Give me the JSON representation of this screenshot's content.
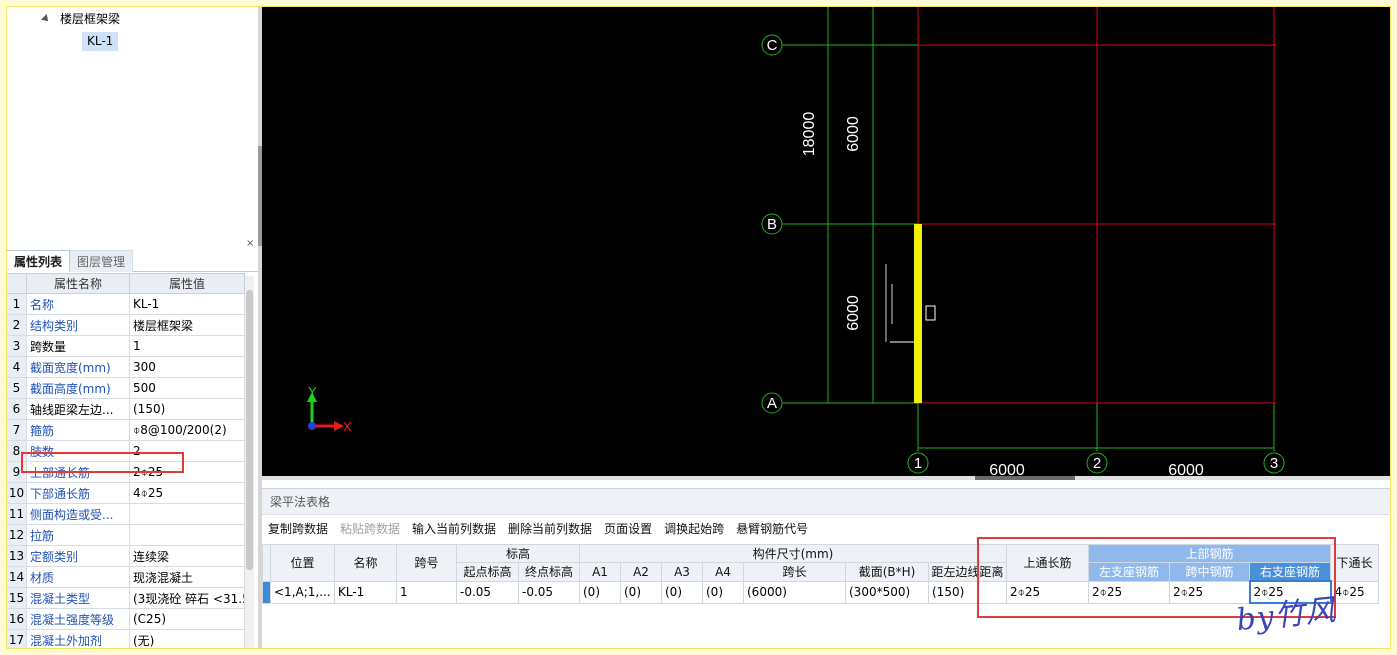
{
  "tree": {
    "node_label": "楼层框架梁",
    "leaf_label": "KL-1"
  },
  "props_panel": {
    "close_glyph": "×",
    "tab_active": "属性列表",
    "tab_inactive": "图层管理",
    "col_name": "属性名称",
    "col_value": "属性值",
    "rows": [
      {
        "num": "1",
        "name": "名称",
        "value": "KL-1",
        "blue": true
      },
      {
        "num": "2",
        "name": "结构类别",
        "value": "楼层框架梁",
        "blue": true
      },
      {
        "num": "3",
        "name": "跨数量",
        "value": "1",
        "blue": false
      },
      {
        "num": "4",
        "name": "截面宽度(mm)",
        "value": "300",
        "blue": true
      },
      {
        "num": "5",
        "name": "截面高度(mm)",
        "value": "500",
        "blue": true
      },
      {
        "num": "6",
        "name": "轴线距梁左边...",
        "value": "(150)",
        "blue": false
      },
      {
        "num": "7",
        "name": "箍筋",
        "value": "⌽8@100/200(2)",
        "blue": true
      },
      {
        "num": "8",
        "name": "肢数",
        "value": "2",
        "blue": true
      },
      {
        "num": "9",
        "name": "上部通长筋",
        "value": "2⌽25",
        "blue": true
      },
      {
        "num": "10",
        "name": "下部通长筋",
        "value": "4⌽25",
        "blue": true
      },
      {
        "num": "11",
        "name": "侧面构造或受...",
        "value": "",
        "blue": true
      },
      {
        "num": "12",
        "name": "拉筋",
        "value": "",
        "blue": true
      },
      {
        "num": "13",
        "name": "定额类别",
        "value": "连续梁",
        "blue": true
      },
      {
        "num": "14",
        "name": "材质",
        "value": "现浇混凝土",
        "blue": true
      },
      {
        "num": "15",
        "name": "混凝土类型",
        "value": "(3现浇砼 碎石 <31.5",
        "blue": true
      },
      {
        "num": "16",
        "name": "混凝土强度等级",
        "value": "(C25)",
        "blue": true
      },
      {
        "num": "17",
        "name": "混凝土外加剂",
        "value": "(无)",
        "blue": true
      }
    ]
  },
  "canvas": {
    "axis_x_label": "X",
    "axis_y_label": "Y",
    "grid_bubbles_row": [
      "C",
      "B",
      "A"
    ],
    "grid_bubbles_col": [
      "1",
      "2",
      "3"
    ],
    "dim_total_vertical": "18000",
    "dim_upper_vertical": "6000",
    "dim_lower_vertical": "6000",
    "dim_span_1": "6000",
    "dim_span_2": "6000",
    "colors": {
      "background": "#000000",
      "axis_red": "#d9001b",
      "dim_green": "#1fb21f",
      "beam_yellow": "#f0f000"
    }
  },
  "grid_panel": {
    "title": "梁平法表格",
    "toolbar": [
      {
        "label": "复制跨数据",
        "enabled": true
      },
      {
        "label": "粘贴跨数据",
        "enabled": false
      },
      {
        "label": "输入当前列数据",
        "enabled": true
      },
      {
        "label": "删除当前列数据",
        "enabled": true
      },
      {
        "label": "页面设置",
        "enabled": true
      },
      {
        "label": "调换起始跨",
        "enabled": true
      },
      {
        "label": "悬臂钢筋代号",
        "enabled": true
      }
    ],
    "headers": {
      "position": "位置",
      "name": "名称",
      "span_no": "跨号",
      "elevation": "标高",
      "start_elev": "起点标高",
      "end_elev": "终点标高",
      "dims": "构件尺寸(mm)",
      "a1": "A1",
      "a2": "A2",
      "a3": "A3",
      "a4": "A4",
      "span_len": "跨长",
      "section": "截面(B*H)",
      "offset": "距左边线距离",
      "top_through": "上通长筋",
      "top_bars": "上部钢筋",
      "left_support": "左支座钢筋",
      "mid_span": "跨中钢筋",
      "right_support": "右支座钢筋",
      "bottom_through": "下通长"
    },
    "row": {
      "position": "<1,A;1,...",
      "name": "KL-1",
      "span_no": "1",
      "start_elev": "-0.05",
      "end_elev": "-0.05",
      "a1": "(0)",
      "a2": "(0)",
      "a3": "(0)",
      "a4": "(0)",
      "span_len": "(6000)",
      "section": "(300*500)",
      "offset": "(150)",
      "top_through": "2⌽25",
      "left_support": "2⌽25",
      "mid_span": "2⌽25",
      "right_support": "2⌽25",
      "bottom_through": "4⌽25"
    }
  },
  "signature": "by竹风"
}
